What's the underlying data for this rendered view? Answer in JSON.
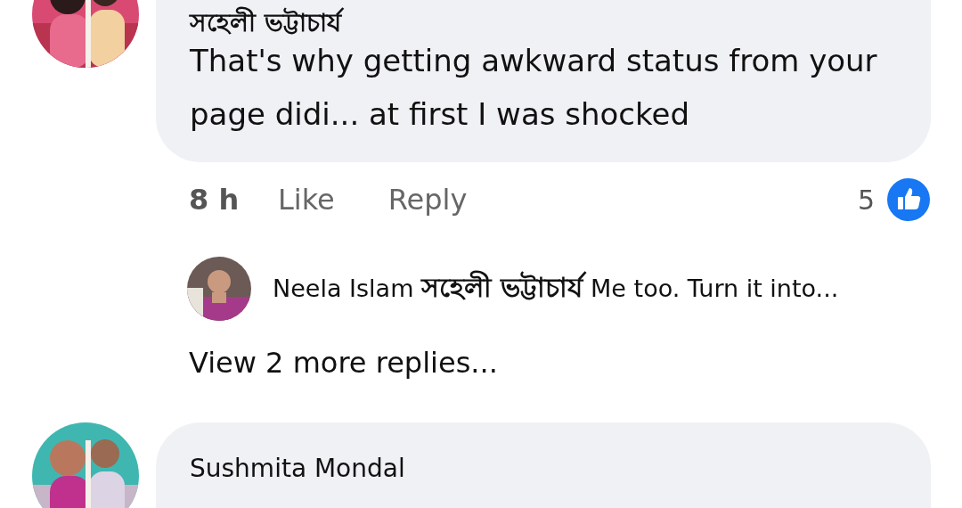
{
  "comments": [
    {
      "author": "সহেলী ভট্টাচার্য",
      "text": "That's why getting awkward status from your page didi... at first I was shocked",
      "time": "8 h",
      "actions": [
        "Like",
        "Reply"
      ],
      "reaction_count": "5",
      "replies": [
        {
          "author": "Neela Islam",
          "mention": "সহেলী ভট্টাচার্য",
          "text": "Me too. Turn it into..."
        }
      ],
      "more_replies": "View 2 more replies..."
    },
    {
      "author": "Sushmita Mondal"
    }
  ]
}
